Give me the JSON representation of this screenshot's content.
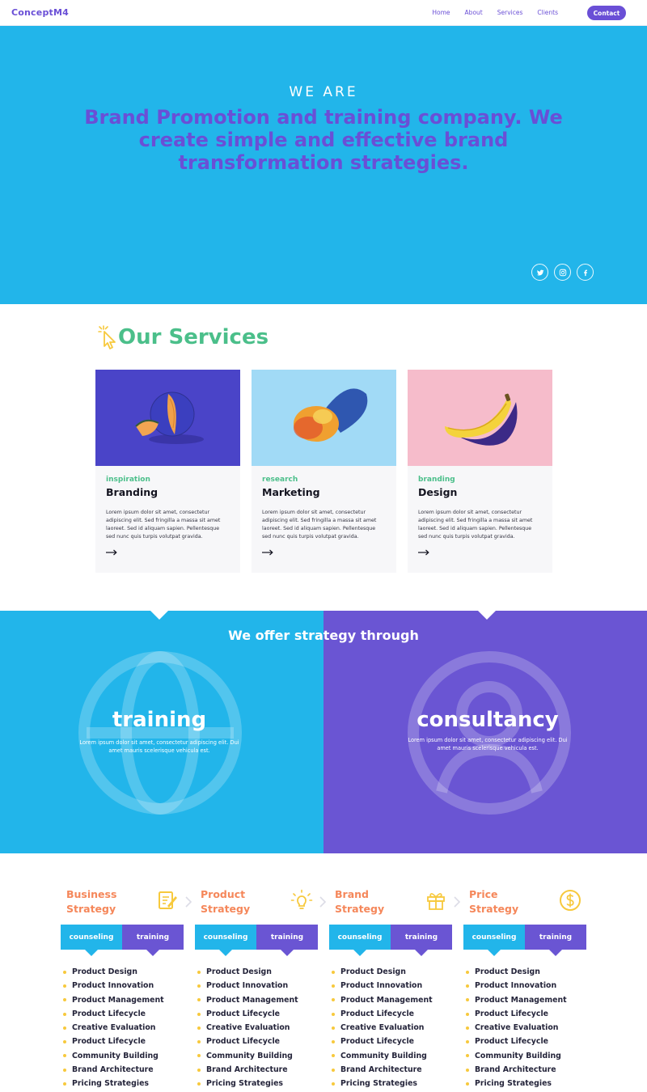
{
  "nav": {
    "logo": "ConceptM4",
    "links": [
      "Home",
      "About",
      "Services",
      "Clients"
    ],
    "contact_label": "Contact",
    "accent": "#6a4fd6"
  },
  "hero": {
    "kicker": "WE ARE",
    "title": "Brand Promotion and training company. We create simple and effective brand transformation strategies.",
    "background": "#22b5ea",
    "socials": [
      "twitter-icon",
      "instagram-icon",
      "facebook-icon"
    ]
  },
  "services": {
    "title": "Our Services",
    "title_color": "#4bbf8a",
    "cards": [
      {
        "tag": "inspiration",
        "title": "Branding",
        "text": "Lorem ipsum dolor sit amet, consectetur adipiscing elit. Sed fringilla a massa sit amet laoreet. Sed id aliquam sapien. Pellentesque sed nunc quis turpis volutpat gravida.",
        "image": "melon",
        "bg": "#4a44c8"
      },
      {
        "tag": "research",
        "title": "Marketing",
        "text": "Lorem ipsum dolor sit amet, consectetur adipiscing elit. Sed fringilla a massa sit amet laoreet. Sed id aliquam sapien. Pellentesque sed nunc quis turpis volutpat gravida.",
        "image": "mango",
        "bg": "#a1daf6"
      },
      {
        "tag": "branding",
        "title": "Design",
        "text": "Lorem ipsum dolor sit amet, consectetur adipiscing elit. Sed fringilla a massa sit amet laoreet. Sed id aliquam sapien. Pellentesque sed nunc quis turpis volutpat gravida.",
        "image": "banana",
        "bg": "#f6bccb"
      }
    ]
  },
  "strategy": {
    "title": "We offer strategy through",
    "left": {
      "word": "training",
      "text": "Lorem ipsum dolor sit amet, consectetur adipiscing elit. Dui amet mauris scelerisque vehicula est.",
      "color": "#22b5ea"
    },
    "right": {
      "word": "consultancy",
      "text": "Lorem ipsum dolor sit amet, consectetur adipiscing elit. Dui amet mauris scelerisque vehicula est.",
      "color": "#6a55d3"
    }
  },
  "columns": {
    "tab_a": "counseling",
    "tab_b": "training",
    "items": [
      "Product Design",
      "Product Innovation",
      "Product Management",
      "Product Lifecycle",
      "Creative Evaluation",
      "Product Lifecycle",
      "Community Building",
      "Brand Architecture",
      "Pricing Strategies"
    ],
    "list": [
      {
        "title_1": "Business",
        "title_2": "Strategy",
        "icon": "notepad-icon"
      },
      {
        "title_1": "Product",
        "title_2": "Strategy",
        "icon": "lightbulb-icon"
      },
      {
        "title_1": "Brand",
        "title_2": "Strategy",
        "icon": "gift-icon"
      },
      {
        "title_1": "Price",
        "title_2": "Strategy",
        "icon": "dollar-icon"
      }
    ]
  }
}
